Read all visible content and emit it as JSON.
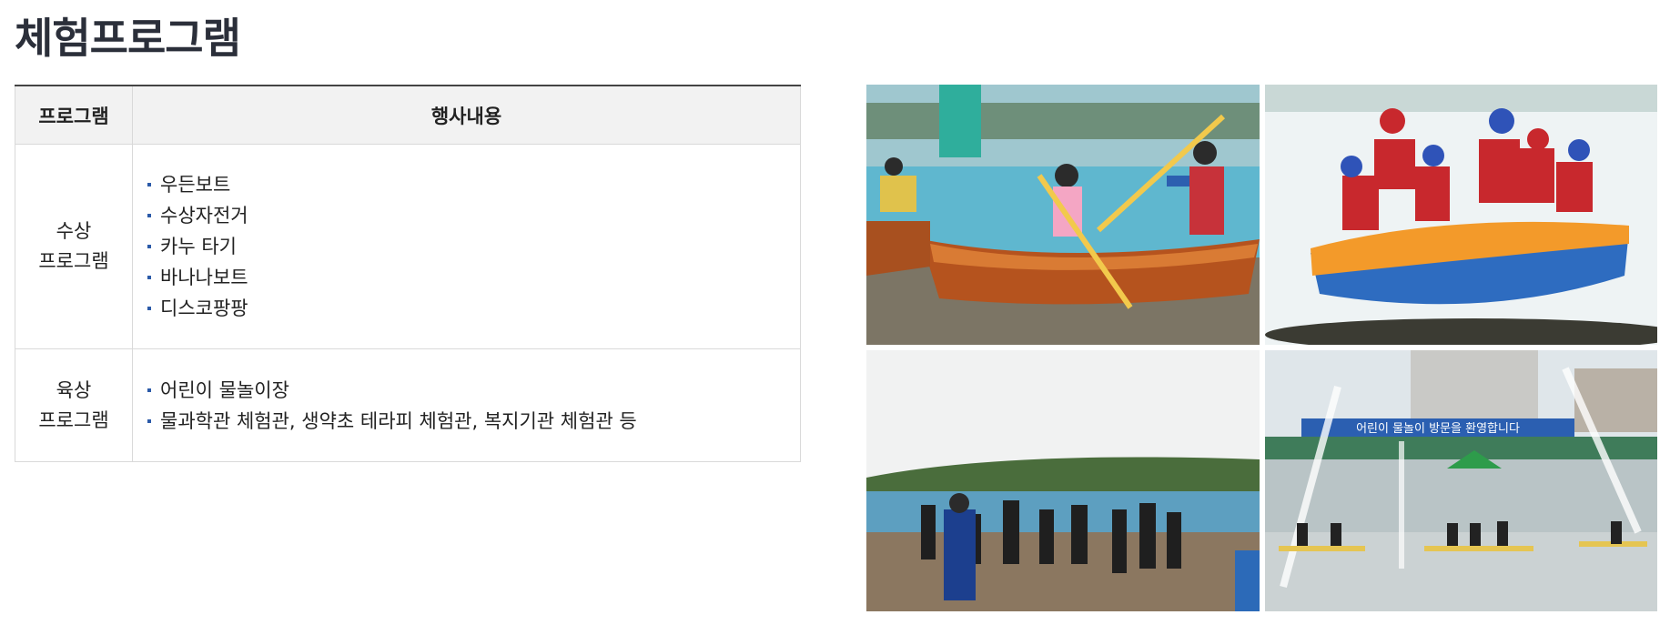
{
  "page": {
    "title": "체험프로그램"
  },
  "table": {
    "headers": {
      "program": "프로그램",
      "content": "행사내용"
    },
    "rows": [
      {
        "category_line1": "수상",
        "category_line2": "프로그램",
        "items": [
          "우든보트",
          "수상자전거",
          "카누 타기",
          "바나나보트",
          "디스코팡팡"
        ]
      },
      {
        "category_line1": "육상",
        "category_line2": "프로그램",
        "items": [
          "어린이 물놀이장",
          "물과학관 체험관, 생약초 테라피 체험관, 복지기관 체험관 등"
        ]
      }
    ]
  },
  "photos": {
    "banner_text": "어린이 물놀이 방문을 환영합니다"
  },
  "colors": {
    "title": "#2b2f3a",
    "bullet": "#2b5aa8",
    "header_bg": "#f2f2f2"
  }
}
